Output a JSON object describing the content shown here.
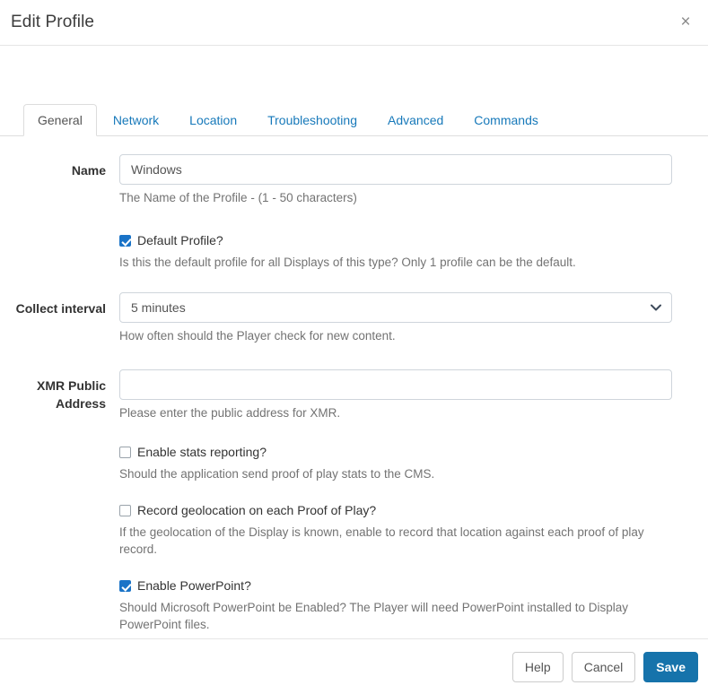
{
  "dialog": {
    "title": "Edit Profile",
    "close_label": "×"
  },
  "tabs": [
    {
      "label": "General",
      "active": true
    },
    {
      "label": "Network",
      "active": false
    },
    {
      "label": "Location",
      "active": false
    },
    {
      "label": "Troubleshooting",
      "active": false
    },
    {
      "label": "Advanced",
      "active": false
    },
    {
      "label": "Commands",
      "active": false
    }
  ],
  "form": {
    "name": {
      "label": "Name",
      "value": "Windows",
      "placeholder": "",
      "help": "The Name of the Profile - (1 - 50 characters)"
    },
    "default_profile": {
      "label": "Default Profile?",
      "checked": true,
      "help": "Is this the default profile for all Displays of this type? Only 1 profile can be the default."
    },
    "collect_interval": {
      "label": "Collect interval",
      "value": "5 minutes",
      "options": [
        "5 minutes"
      ],
      "help": "How often should the Player check for new content."
    },
    "xmr_public_address": {
      "label": "XMR Public Address",
      "value": "",
      "placeholder": "",
      "help": "Please enter the public address for XMR."
    },
    "stats_reporting": {
      "label": "Enable stats reporting?",
      "checked": false,
      "help": "Should the application send proof of play stats to the CMS."
    },
    "record_geolocation": {
      "label": "Record geolocation on each Proof of Play?",
      "checked": false,
      "help": "If the geolocation of the Display is known, enable to record that location against each proof of play record."
    },
    "enable_powerpoint": {
      "label": "Enable PowerPoint?",
      "checked": true,
      "help": "Should Microsoft PowerPoint be Enabled? The Player will need PowerPoint installed to Display PowerPoint files."
    }
  },
  "footer": {
    "help_label": "Help",
    "cancel_label": "Cancel",
    "save_label": "Save"
  },
  "colors": {
    "primary": "#1673ab",
    "link": "#1779ba",
    "checkbox_checked": "#1a73c7",
    "border": "#dddddd",
    "help_text": "#737373"
  }
}
